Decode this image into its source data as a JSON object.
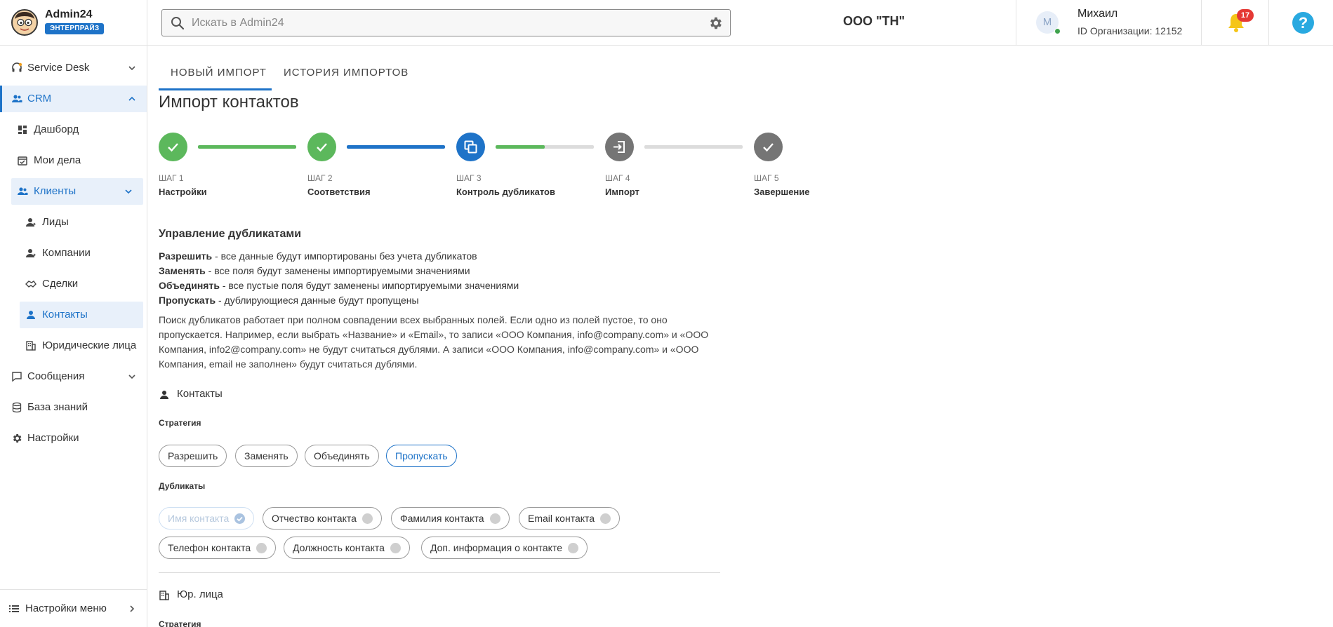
{
  "brand": {
    "name": "Admin24",
    "badge": "ЭНТЕРПРАЙЗ"
  },
  "search": {
    "placeholder": "Искать в Admin24"
  },
  "org_title": "ООО \"ТН\"",
  "user": {
    "initial": "М",
    "name": "Михаил",
    "org": "ID Организации: 12152"
  },
  "notifications": {
    "count": "17"
  },
  "help": {
    "glyph": "?"
  },
  "sidebar": {
    "items": [
      {
        "label": "Service Desk"
      },
      {
        "label": "CRM"
      },
      {
        "label": "Дашборд"
      },
      {
        "label": "Мои дела"
      },
      {
        "label": "Клиенты"
      },
      {
        "label": "Лиды"
      },
      {
        "label": "Компании"
      },
      {
        "label": "Сделки"
      },
      {
        "label": "Контакты"
      },
      {
        "label": "Юридические лица"
      },
      {
        "label": "Сообщения"
      },
      {
        "label": "База знаний"
      },
      {
        "label": "Настройки"
      }
    ],
    "footer": "Настройки меню"
  },
  "tabs": [
    {
      "label": "НОВЫЙ ИМПОРТ"
    },
    {
      "label": "ИСТОРИЯ ИМПОРТОВ"
    }
  ],
  "page_title": "Импорт контактов",
  "steps": [
    {
      "num": "ШАГ 1",
      "label": "Настройки",
      "status": "done"
    },
    {
      "num": "ШАГ 2",
      "label": "Соответствия",
      "status": "done"
    },
    {
      "num": "ШАГ 3",
      "label": "Контроль дубликатов",
      "status": "current"
    },
    {
      "num": "ШАГ 4",
      "label": "Импорт",
      "status": "pending"
    },
    {
      "num": "ШАГ 5",
      "label": "Завершение",
      "status": "pending"
    }
  ],
  "step_progress": [
    1,
    1,
    0.5,
    0
  ],
  "colors": {
    "accent": "#1e73c8",
    "done": "#5cb85c",
    "pending": "#757575"
  },
  "duplicates": {
    "title": "Управление дубликатами",
    "definitions": [
      {
        "term": "Разрешить",
        "text": " - все данные будут импортированы без учета дубликатов"
      },
      {
        "term": "Заменять",
        "text": " - все поля будут заменены импортируемыми значениями"
      },
      {
        "term": "Объединять",
        "text": " - все пустые поля будут заменены импортируемыми значениями"
      },
      {
        "term": "Пропускать",
        "text": " - дублирующиеся данные будут пропущены"
      }
    ],
    "description": "Поиск дубликатов работает при полном совпадении всех выбранных полей. Если одно из полей пустое, то оно пропускается. Например, если выбрать «Название» и «Email», то записи «ООО Компания, info@company.com» и «ООО Компания, info2@company.com» не будут считаться дублями. А записи «ООО Компания, info@company.com» и «ООО Компания, email не заполнен» будут считаться дублями."
  },
  "contacts": {
    "title": "Контакты",
    "strategy_label": "Стратегия",
    "strategies": [
      "Разрешить",
      "Заменять",
      "Объединять",
      "Пропускать"
    ],
    "selected_strategy": "Пропускать",
    "duplicates_label": "Дубликаты",
    "fields": [
      {
        "label": "Имя контакта",
        "state": "locked-checked"
      },
      {
        "label": "Отчество контакта",
        "state": "unchecked"
      },
      {
        "label": "Фамилия контакта",
        "state": "unchecked"
      },
      {
        "label": "Email контакта",
        "state": "unchecked"
      },
      {
        "label": "Телефон контакта",
        "state": "unchecked"
      },
      {
        "label": "Должность контакта",
        "state": "unchecked"
      },
      {
        "label": "Доп. информация о контакте",
        "state": "unchecked"
      }
    ]
  },
  "legal": {
    "title": "Юр. лица",
    "strategy_label": "Стратегия"
  }
}
